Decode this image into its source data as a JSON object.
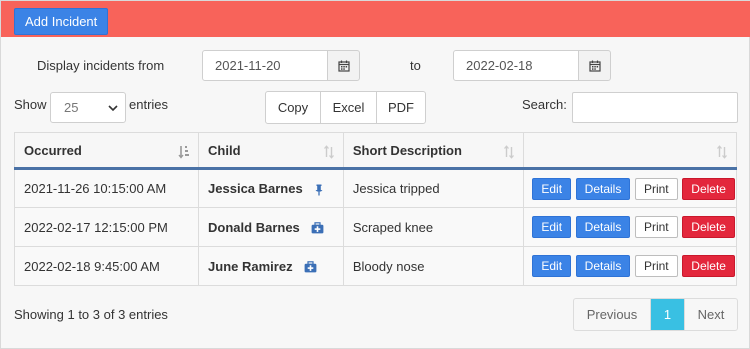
{
  "toolbar": {
    "add_incident_label": "Add Incident"
  },
  "filters": {
    "display_from_label": "Display incidents from",
    "from_date": "2021-11-20",
    "to_label": "to",
    "to_date": "2022-02-18"
  },
  "length": {
    "show_label": "Show",
    "value": "25",
    "entries_label": "entries"
  },
  "export": {
    "copy": "Copy",
    "excel": "Excel",
    "pdf": "PDF"
  },
  "search": {
    "label": "Search:",
    "value": ""
  },
  "table": {
    "headers": [
      "Occurred",
      "Child",
      "Short Description",
      ""
    ],
    "rows": [
      {
        "occurred": "2021-11-26 10:15:00 AM",
        "child": "Jessica Barnes",
        "icon": "pin-icon",
        "description": "Jessica tripped"
      },
      {
        "occurred": "2022-02-17 12:15:00 PM",
        "child": "Donald Barnes",
        "icon": "medkit-icon",
        "description": "Scraped knee"
      },
      {
        "occurred": "2022-02-18 9:45:00 AM",
        "child": "June Ramirez",
        "icon": "medkit-icon",
        "description": "Bloody nose"
      }
    ],
    "actions": {
      "edit": "Edit",
      "details": "Details",
      "print": "Print",
      "delete": "Delete"
    }
  },
  "footer": {
    "info": "Showing 1 to 3 of 3 entries",
    "previous": "Previous",
    "current_page": "1",
    "next": "Next"
  },
  "colors": {
    "topbar": "#f8635a",
    "primary": "#3b83e6",
    "danger": "#e3273c",
    "active_page": "#39c0e3",
    "header_underline": "#4a72a6"
  }
}
